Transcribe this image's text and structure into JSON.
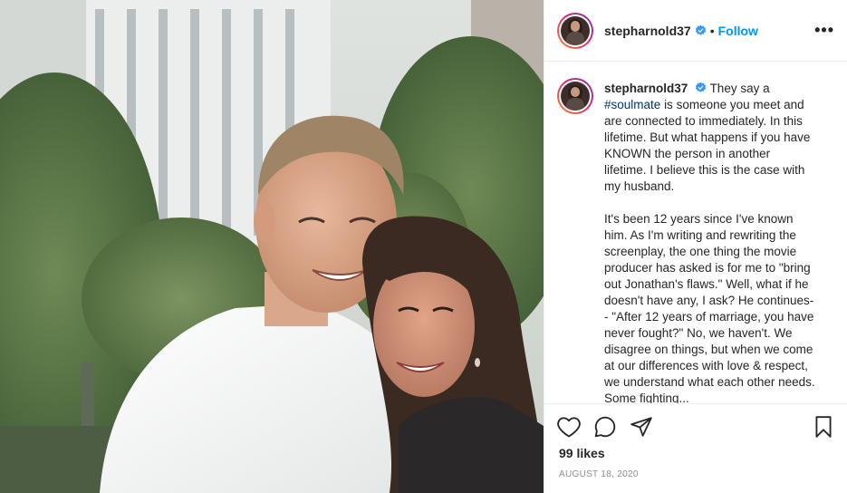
{
  "post": {
    "username": "stepharnold37",
    "follow_label": "Follow",
    "separator": "•",
    "more_label": "•••",
    "caption": {
      "username": "stepharnold37",
      "intro": "They say a",
      "hashtag": "#soulmate",
      "lines": [
        "is someone you meet and",
        "are connected to immediately. In this",
        "lifetime. But what happens if you have",
        "KNOWN the person in another",
        "lifetime. I believe this is the case with",
        "my husband."
      ],
      "paragraph2": [
        "It's been 12 years since I've known",
        "him. As I'm writing and rewriting the",
        "screenplay, the one thing the movie",
        "producer has asked is for me to \"bring",
        "out Jonathan's flaws.\" Well, what if he",
        "doesn't have any, I ask? He continues-",
        "- \"After 12 years of marriage, you have",
        "never fought?\" No, we haven't. We",
        "disagree on things, but when we come",
        "at our differences with love & respect,",
        "we understand what each other needs.",
        "Some fighting..."
      ]
    },
    "likes": "99 likes",
    "date": "AUGUST 18, 2020"
  },
  "colors": {
    "link_blue": "#0095f6",
    "hashtag": "#00376b",
    "muted": "#8e8e8e",
    "verified": "#3897f0"
  },
  "icons": {
    "like": "heart-icon",
    "comment": "comment-icon",
    "share": "paper-plane-icon",
    "save": "bookmark-icon",
    "verified": "verified-badge-icon",
    "more": "more-options-icon"
  }
}
